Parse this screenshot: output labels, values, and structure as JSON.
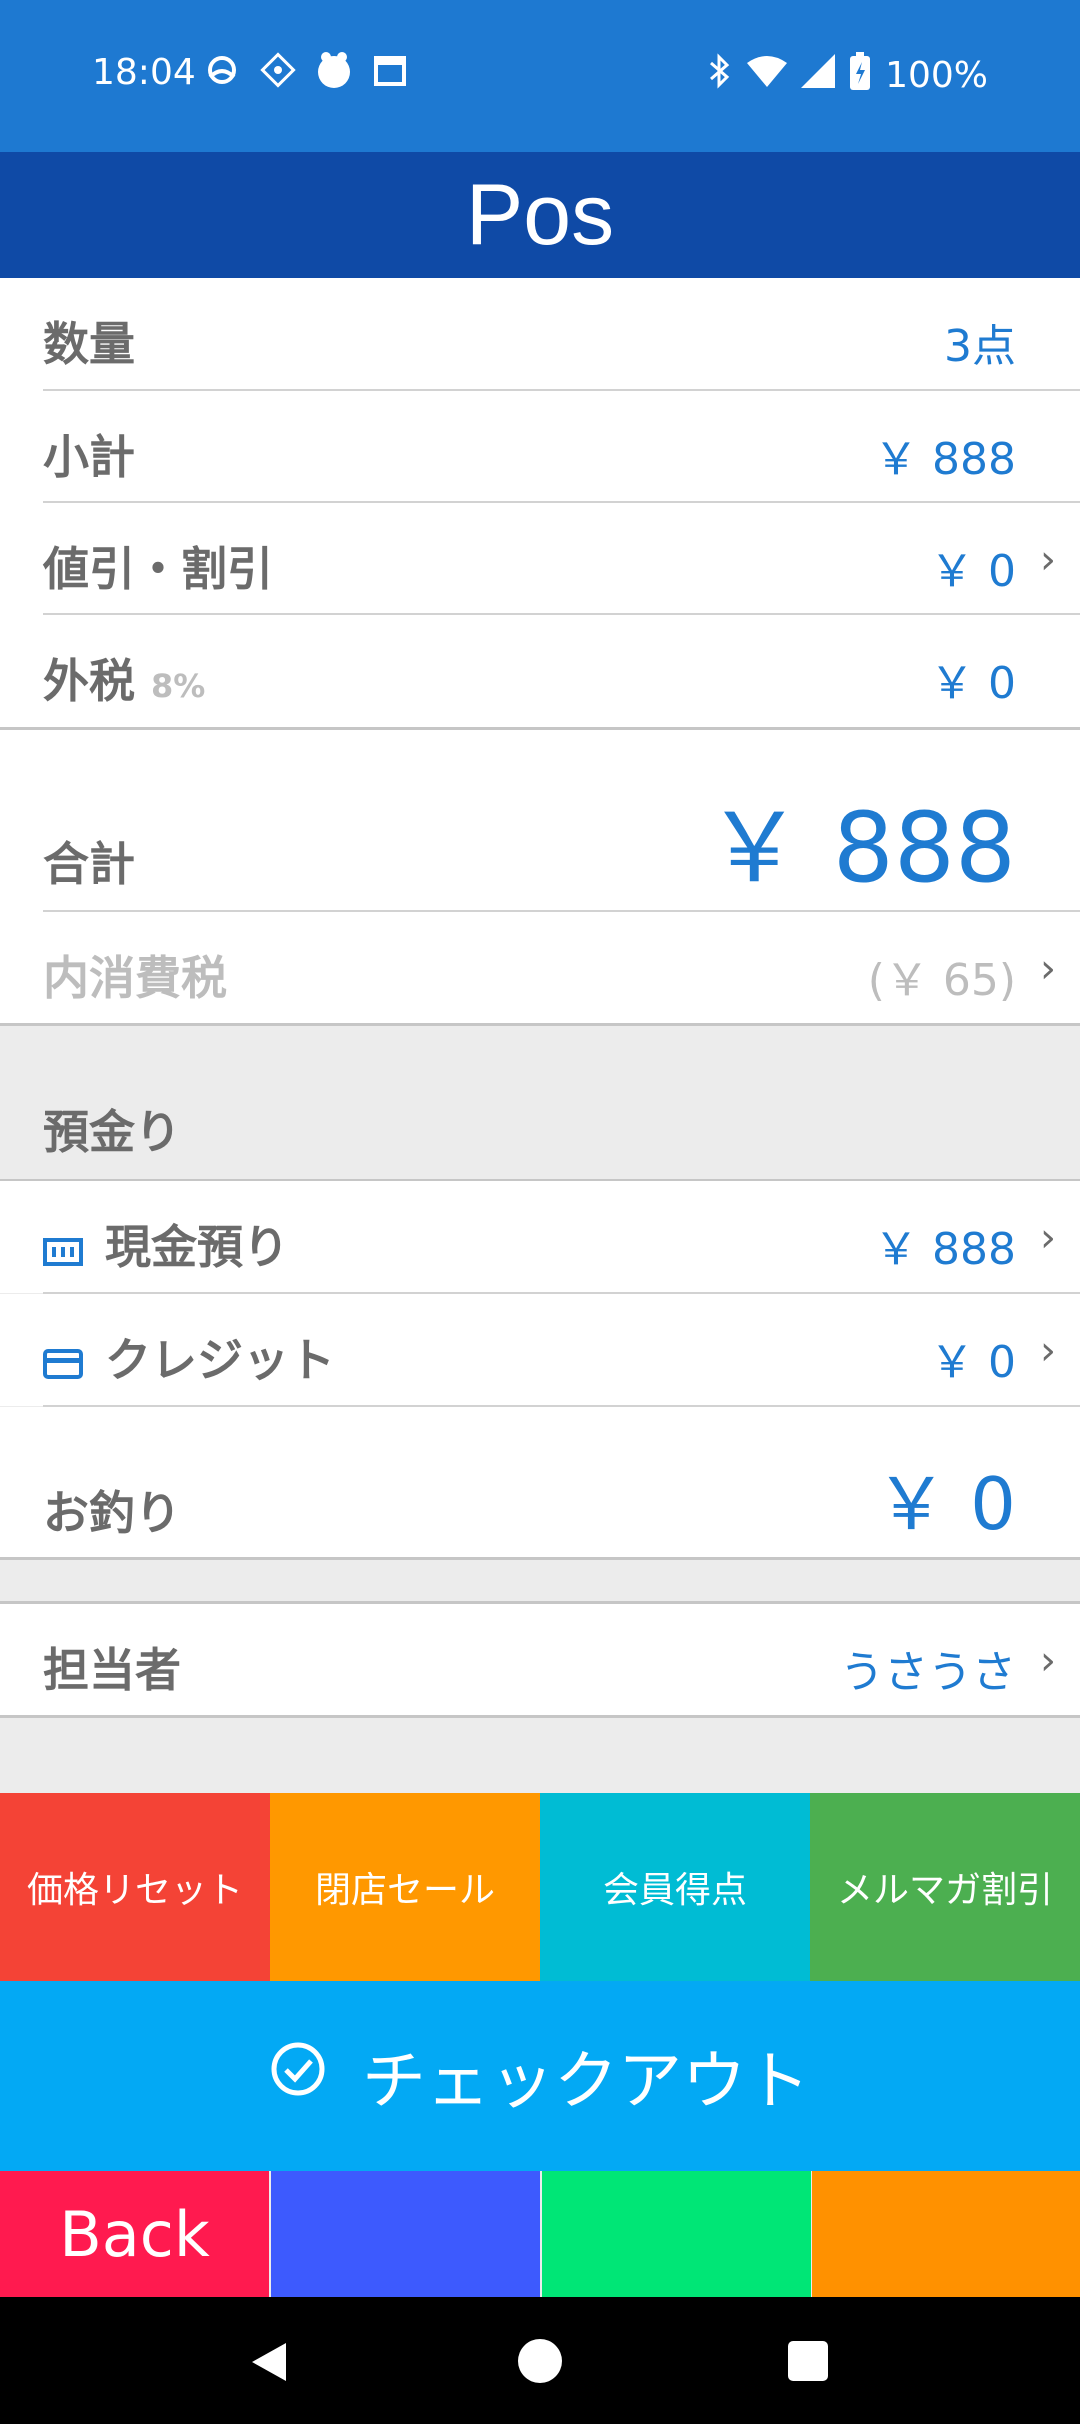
{
  "status_bar": {
    "time": "18:04",
    "battery": "100%",
    "left_icons": [
      "weather-icon",
      "app-icon",
      "app-icon-2",
      "calendar-icon"
    ],
    "right_icons": [
      "bluetooth-icon",
      "wifi-icon",
      "signal-icon",
      "battery-icon"
    ]
  },
  "title": "Pos",
  "summary": {
    "quantity": {
      "label": "数量",
      "value": "3点"
    },
    "subtotal": {
      "label": "小計",
      "value": "￥ 888"
    },
    "discount": {
      "label": "値引・割引",
      "value": "￥ 0"
    },
    "tax": {
      "label": "外税",
      "rate": "8%",
      "value": "￥ 0"
    },
    "total": {
      "label": "合計",
      "value": "￥ 888"
    },
    "inner_tax": {
      "label": "内消費税",
      "value": "(￥ 65)"
    }
  },
  "deposit": {
    "header": "預金り",
    "cash": {
      "label": "現金預り",
      "value": "￥ 888"
    },
    "credit": {
      "label": "クレジット",
      "value": "￥ 0"
    },
    "change": {
      "label": "お釣り",
      "value": "￥ 0"
    }
  },
  "staff": {
    "label": "担当者",
    "value": "うさうさ"
  },
  "quick_buttons": [
    {
      "label": "価格リセット",
      "color": "#f44336"
    },
    {
      "label": "閉店セール",
      "color": "#ff9800"
    },
    {
      "label": "会員得点",
      "color": "#00bcd4"
    },
    {
      "label": "メルマガ割引",
      "color": "#4caf50"
    }
  ],
  "checkout": {
    "label": "チェックアウト",
    "color": "#03a9f4"
  },
  "bottom_buttons": [
    {
      "label": "Back",
      "color": "#ff1a4f"
    },
    {
      "label": "",
      "color": "#3d5afe"
    },
    {
      "label": "",
      "color": "#00e676"
    },
    {
      "label": "",
      "color": "#ff9100"
    }
  ],
  "colors": {
    "status_bar": "#1e79d1",
    "title_bar": "#0f4aa6",
    "accent_text": "#1f7bd1"
  }
}
